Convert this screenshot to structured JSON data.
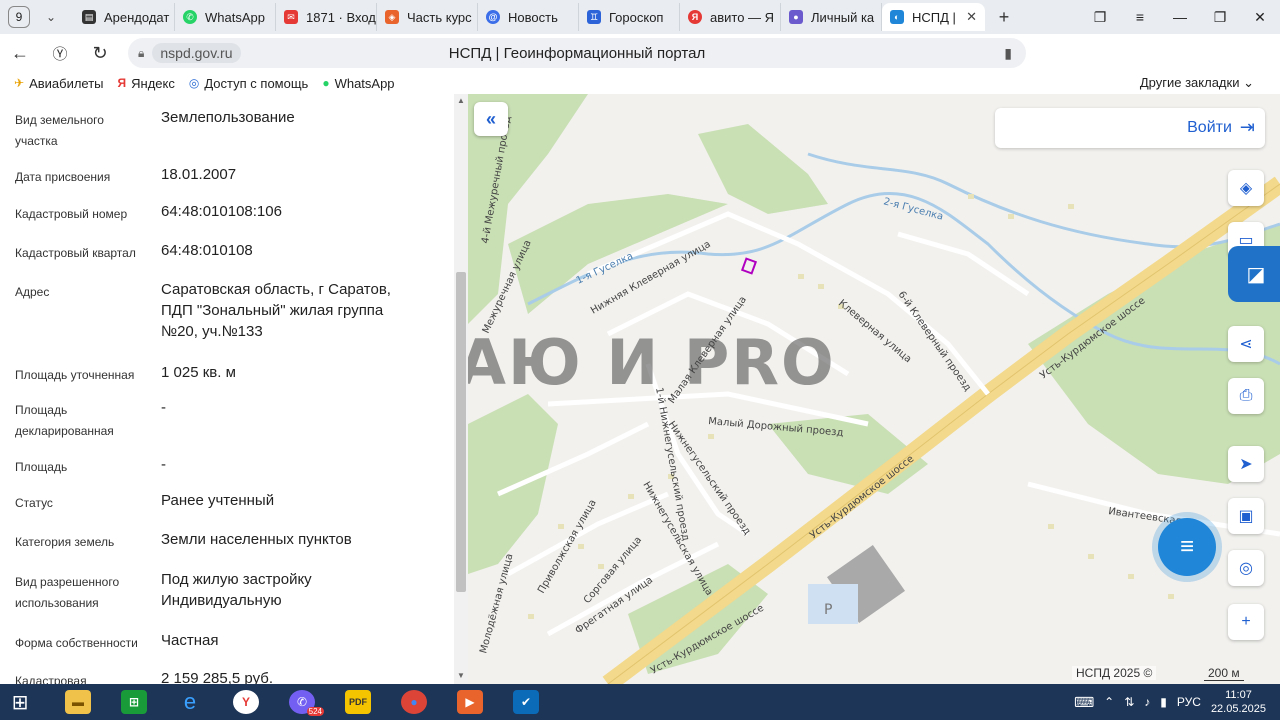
{
  "browser": {
    "tab_counter": "9",
    "tabs": [
      {
        "title": "Арендодат",
        "icon": "ruler-icon",
        "color": "#333333"
      },
      {
        "title": "WhatsApp",
        "icon": "whatsapp-icon",
        "color": "#25d366"
      },
      {
        "title": "1871 · Вход",
        "icon": "mail-icon",
        "color": "#e53935"
      },
      {
        "title": "Часть курс",
        "icon": "course-icon",
        "color": "#e8642c"
      },
      {
        "title": "Новость",
        "icon": "news-icon",
        "color": "#3b6ee8"
      },
      {
        "title": "Гороскоп",
        "icon": "horoscope-icon",
        "color": "#2d63d9"
      },
      {
        "title": "авито — Я",
        "icon": "yandex-icon",
        "color": "#e53935"
      },
      {
        "title": "Личный ка",
        "icon": "cabinet-icon",
        "color": "#6a5acd"
      },
      {
        "title": "НСПД |",
        "icon": "nspd-icon",
        "color": "#1f86d8"
      }
    ],
    "new_tab": "+",
    "url_domain": "nspd.gov.ru",
    "page_title": "НСПД | Геоинформационный портал",
    "bookmarks": [
      {
        "label": "Авиабилеты",
        "icon": "plane-icon"
      },
      {
        "label": "Яндекс",
        "icon": "yandex-icon"
      },
      {
        "label": "Доступ с помощь",
        "icon": "access-icon"
      },
      {
        "label": "WhatsApp",
        "icon": "whatsapp-icon"
      }
    ],
    "other_bookmarks": "Другие закладки"
  },
  "details": [
    {
      "label": "Вид земельного участка",
      "value": "Землепользование"
    },
    {
      "label": "Дата присвоения",
      "value": "18.01.2007"
    },
    {
      "label": "Кадастровый номер",
      "value": "64:48:010108:106"
    },
    {
      "label": "Кадастровый квартал",
      "value": "64:48:010108"
    },
    {
      "label": "Адрес",
      "value": "Саратовская область, г Саратов, ПДП \"Зональный\" жилая группа №20, уч.№133"
    },
    {
      "label": "Площадь уточненная",
      "value": "1 025 кв. м"
    },
    {
      "label": "Площадь декларированная",
      "value": "-"
    },
    {
      "label": "Площадь",
      "value": "-"
    },
    {
      "label": "Статус",
      "value": "Ранее учтенный"
    },
    {
      "label": "Категория земель",
      "value": "Земли населенных пунктов"
    },
    {
      "label": "Вид разрешенного использования",
      "value": "Под жилую застройку Индивидуальную"
    },
    {
      "label": "Форма собственности",
      "value": "Частная"
    },
    {
      "label": "Кадастровая",
      "value": "2 159 285,5 руб."
    }
  ],
  "map": {
    "login_label": "Войти",
    "watermark": "АЮ И PRO",
    "copyright": "НСПД 2025 ©",
    "scale": "200 м",
    "streets": {
      "highway_1": "Усть-Курдюмское шоссе",
      "highway_2": "Усть-Курдюмское шоссе",
      "highway_3": "Усть-Курдюмское шоссе",
      "s1": "Нижняя Клеверная улица",
      "s2": "Клеверная улица",
      "s3": "6-й Клеверный проезд",
      "s4": "Малая Клеверная улица",
      "s5": "Малый Дорожный проезд",
      "s6": "1-й Нижнегусельский проезд",
      "s7": "Нижнегусельский проезд",
      "s8": "Нижнегусельская улица",
      "s9": "Межуречная улица",
      "s10": "4-й Межуречный проезд",
      "s11": "Приволжская улица",
      "s12": "Сорговая улица",
      "s13": "Фрегатная улица",
      "s14": "Молодёжная улица",
      "s15": "Ивантеевская",
      "river1": "1-я Гуселка",
      "river2": "2-я Гуселка",
      "parking": "P"
    }
  },
  "taskbar": {
    "viber_badge": "524",
    "lang": "РУС",
    "time": "11:07",
    "date": "22.05.2025"
  }
}
